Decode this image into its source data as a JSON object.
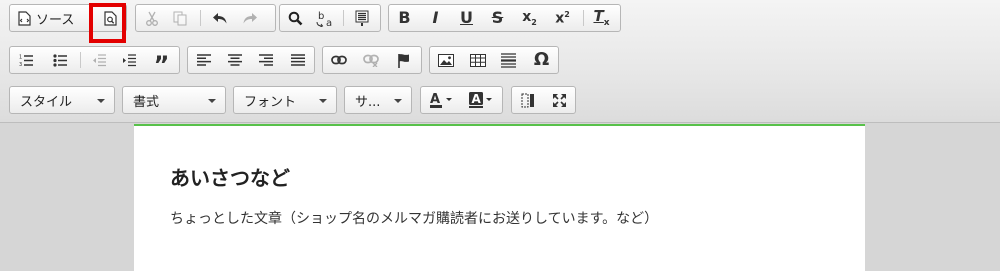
{
  "toolbar": {
    "source_label": "ソース",
    "style_combo": "スタイル",
    "format_combo": "書式",
    "font_combo": "フォント",
    "size_combo": "サ...",
    "highlighted_button": "preview",
    "highlight_color": "#e30000"
  },
  "icons": [
    "source-icon",
    "preview-icon",
    "cut-icon",
    "copy-icon",
    "undo-icon",
    "redo-icon",
    "find-icon",
    "replace-icon",
    "select-all-icon",
    "bold-icon",
    "italic-icon",
    "underline-icon",
    "strikethrough-icon",
    "subscript-icon",
    "superscript-icon",
    "remove-format-icon",
    "numbered-list-icon",
    "bulleted-list-icon",
    "decrease-indent-icon",
    "increase-indent-icon",
    "blockquote-icon",
    "align-left-icon",
    "align-center-icon",
    "align-right-icon",
    "justify-icon",
    "link-icon",
    "unlink-icon",
    "anchor-icon",
    "image-icon",
    "table-icon",
    "horizontal-line-icon",
    "special-char-icon",
    "text-color-icon",
    "background-color-icon",
    "show-blocks-icon",
    "maximize-icon"
  ],
  "editor": {
    "title": "あいさつなど",
    "body": "ちょっとした文章（ショップ名のメルマガ購読者にお送りしています。など）",
    "accent_color": "#58c14a"
  }
}
